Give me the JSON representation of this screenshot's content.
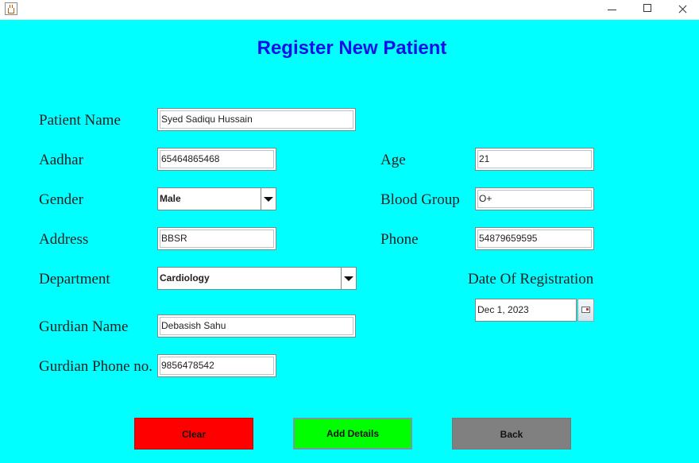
{
  "window": {
    "icon": "java-cup-icon",
    "controls": [
      "minimize-icon",
      "maximize-icon",
      "close-icon"
    ]
  },
  "form": {
    "title": "Register New Patient",
    "patient_name": {
      "label": "Patient Name",
      "value": "Syed Sadiqu Hussain"
    },
    "aadhar": {
      "label": "Aadhar",
      "value": "65464865468"
    },
    "age": {
      "label": "Age",
      "value": "21"
    },
    "gender": {
      "label": "Gender",
      "selected": "Male"
    },
    "blood_group": {
      "label": "Blood Group",
      "value": "O+"
    },
    "address": {
      "label": "Address",
      "value": "BBSR"
    },
    "phone": {
      "label": "Phone",
      "value": "54879659595"
    },
    "department": {
      "label": "Department",
      "selected": "Cardiology"
    },
    "date_of_registration": {
      "label": "Date Of Registration",
      "value": "Dec 1, 2023"
    },
    "gurdian_name": {
      "label": "Gurdian Name",
      "value": "Debasish Sahu"
    },
    "gurdian_phone": {
      "label": "Gurdian Phone no.",
      "value": "9856478542"
    }
  },
  "buttons": {
    "clear": "Clear",
    "add": "Add Details",
    "back": "Back"
  },
  "colors": {
    "background": "#00FFFF",
    "title": "#1010E8",
    "clear_button": "#FF0000",
    "add_button": "#00FF00",
    "back_button": "#808080"
  }
}
